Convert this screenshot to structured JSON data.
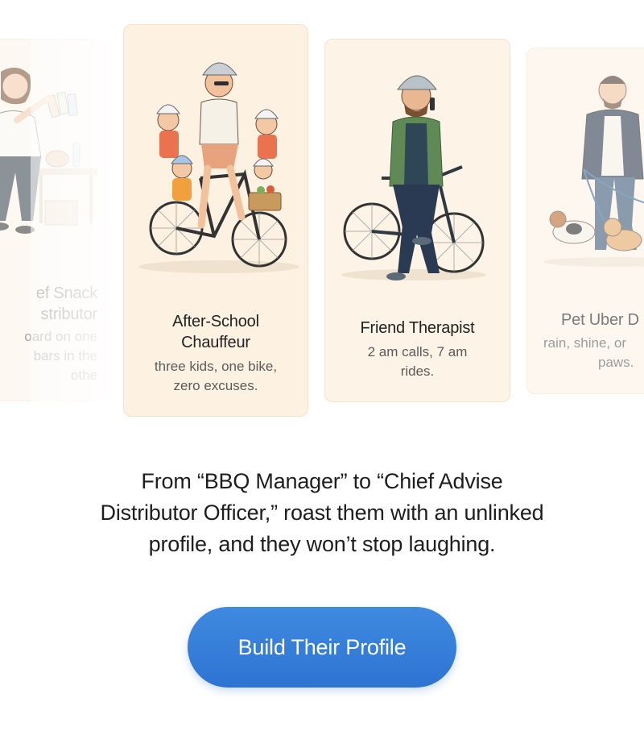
{
  "carousel": {
    "cards": [
      {
        "title_line1": "ef Snack",
        "title_line2": "stributor",
        "sub_line1": "oard on one",
        "sub_line2": "bars in the",
        "sub_line3": "othe"
      },
      {
        "title_line1": "After-School",
        "title_line2": "Chauffeur",
        "sub_line1": "three kids, one bike,",
        "sub_line2": "zero excuses."
      },
      {
        "title_line1": "Friend Therapist",
        "sub_line1": "2 am calls, 7 am",
        "sub_line2": "rides."
      },
      {
        "title_line1": "Pet Uber D",
        "sub_line1": "rain, shine, or",
        "sub_line2": "paws."
      }
    ]
  },
  "headline": {
    "line1": "From “BBQ Manager” to “Chief Advise",
    "line2": "Distributor Officer,” roast them with an unlinked",
    "line3": "profile, and they won’t stop laughing."
  },
  "cta": {
    "label": "Build Their Profile"
  },
  "colors": {
    "card_bg": "#fdf3e6",
    "cta_blue": "#2f78d6"
  },
  "icons": [
    "woman-illustration",
    "bike-family-illustration",
    "cyclist-phone-illustration",
    "dog-walker-illustration"
  ]
}
